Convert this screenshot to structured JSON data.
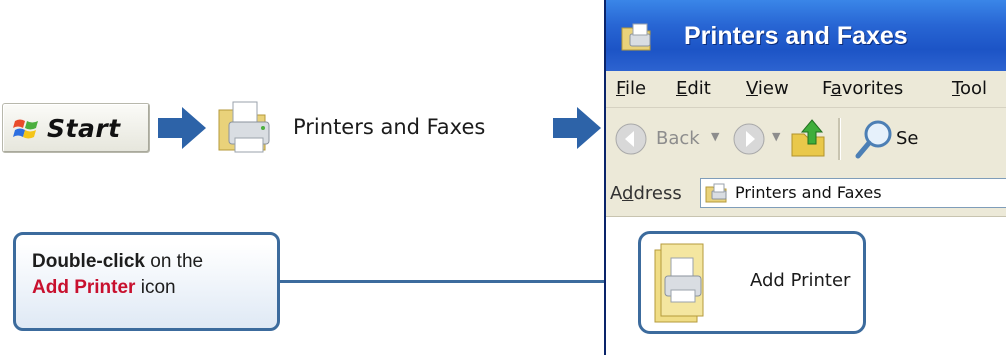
{
  "start": {
    "label": "Start"
  },
  "printers_item": {
    "label": "Printers and Faxes"
  },
  "callout": {
    "bold_text": "Double-click",
    "mid_text": " on the",
    "highlight_text": "Add Printer",
    "end_text": " icon"
  },
  "window": {
    "title": "Printers and Faxes",
    "menu": [
      "File",
      "Edit",
      "View",
      "Favorites",
      "Tool"
    ],
    "menu_underline": [
      "F",
      "E",
      "V",
      "a",
      "T"
    ],
    "toolbar": {
      "back_label": "Back",
      "search_label": "Se"
    },
    "address": {
      "label": "Address",
      "value": "Printers and Faxes"
    },
    "item": {
      "label": "Add Printer"
    }
  },
  "colors": {
    "accent": "#3c6b9d",
    "highlight": "#c8102e",
    "titlebar": "#2866d4"
  }
}
